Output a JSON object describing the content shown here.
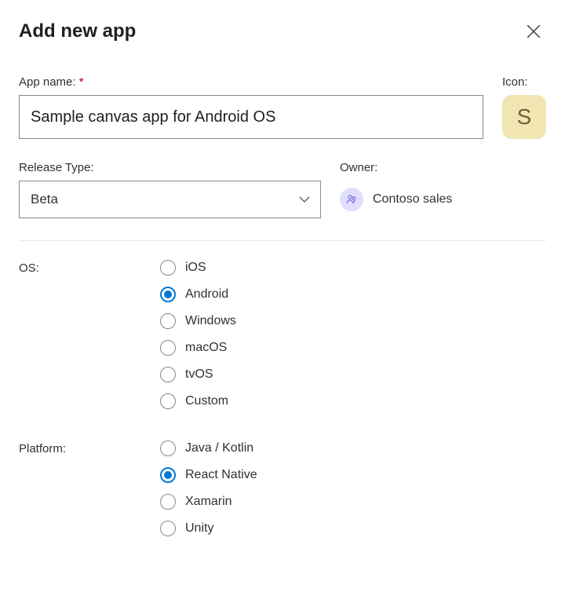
{
  "dialog": {
    "title": "Add new app"
  },
  "appName": {
    "label": "App name:",
    "value": "Sample canvas app for Android OS"
  },
  "icon": {
    "label": "Icon:",
    "letter": "S"
  },
  "releaseType": {
    "label": "Release Type:",
    "selected": "Beta"
  },
  "owner": {
    "label": "Owner:",
    "name": "Contoso sales"
  },
  "os": {
    "label": "OS:",
    "options": [
      "iOS",
      "Android",
      "Windows",
      "macOS",
      "tvOS",
      "Custom"
    ],
    "selected": "Android"
  },
  "platform": {
    "label": "Platform:",
    "options": [
      "Java / Kotlin",
      "React Native",
      "Xamarin",
      "Unity"
    ],
    "selected": "React Native"
  }
}
